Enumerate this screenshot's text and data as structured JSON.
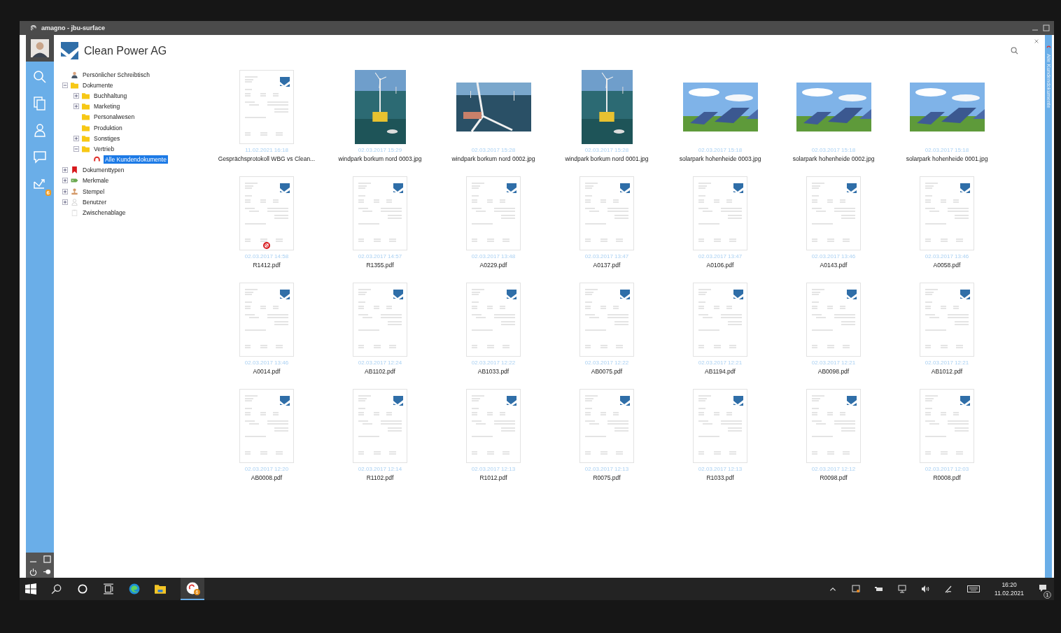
{
  "window": {
    "title": "amagno - jbu-surface"
  },
  "sidebar": {
    "inbox_badge": "6"
  },
  "header": {
    "title": "Clean Power AG"
  },
  "side_strip": {
    "label": "Alle Kundendokumente"
  },
  "tree": [
    {
      "label": "Persönlicher Schreibtisch",
      "kind": "person",
      "selected": false
    },
    {
      "label": "Dokumente",
      "kind": "folder",
      "selected": false,
      "expanded": true,
      "children": [
        {
          "label": "Buchhaltung",
          "kind": "folder",
          "selected": false,
          "expanded": false
        },
        {
          "label": "Marketing",
          "kind": "folder",
          "selected": false,
          "expanded": false
        },
        {
          "label": "Personalwesen",
          "kind": "folder",
          "selected": false
        },
        {
          "label": "Produktion",
          "kind": "folder",
          "selected": false
        },
        {
          "label": "Sonstiges",
          "kind": "folder",
          "selected": false,
          "expanded": false
        },
        {
          "label": "Vertrieb",
          "kind": "folder",
          "selected": false,
          "expanded": true,
          "children": [
            {
              "label": "Alle Kundendokumente",
              "kind": "query",
              "selected": true
            }
          ]
        }
      ]
    },
    {
      "label": "Dokumenttypen",
      "kind": "bookmark",
      "selected": false,
      "expanded": false
    },
    {
      "label": "Merkmale",
      "kind": "tag",
      "selected": false,
      "expanded": false
    },
    {
      "label": "Stempel",
      "kind": "stamp",
      "selected": false,
      "expanded": false
    },
    {
      "label": "Benutzer",
      "kind": "user",
      "selected": false,
      "expanded": false
    },
    {
      "label": "Zwischenablage",
      "kind": "clipboard",
      "selected": false
    }
  ],
  "files": [
    {
      "kind": "document",
      "date": "11.02.2021 16:18",
      "name": "Gesprächsprotokoll WBG vs Clean...",
      "marked": false
    },
    {
      "kind": "picture",
      "date": "02.03.2017 15:29",
      "name": "windpark borkum nord 0003.jpg"
    },
    {
      "kind": "picture",
      "date": "02.03.2017 15:28",
      "name": "windpark borkum nord 0002.jpg"
    },
    {
      "kind": "picture",
      "date": "02.03.2017 15:28",
      "name": "windpark borkum nord 0001.jpg"
    },
    {
      "kind": "picture",
      "date": "02.03.2017 15:18",
      "name": "solarpark hohenheide 0003.jpg"
    },
    {
      "kind": "picture",
      "date": "02.03.2017 15:18",
      "name": "solarpark hohenheide 0002.jpg"
    },
    {
      "kind": "picture",
      "date": "02.03.2017 15:18",
      "name": "solarpark hohenheide 0001.jpg"
    },
    {
      "kind": "document",
      "date": "02.03.2017 14:58",
      "name": "R1412.pdf",
      "marked": true
    },
    {
      "kind": "document",
      "date": "02.03.2017 14:57",
      "name": "R1355.pdf",
      "marked": false
    },
    {
      "kind": "document",
      "date": "02.03.2017 13:48",
      "name": "A0229.pdf",
      "marked": false
    },
    {
      "kind": "document",
      "date": "02.03.2017 13:47",
      "name": "A0137.pdf",
      "marked": false
    },
    {
      "kind": "document",
      "date": "02.03.2017 13:47",
      "name": "A0106.pdf",
      "marked": false
    },
    {
      "kind": "document",
      "date": "02.03.2017 13:46",
      "name": "A0143.pdf",
      "marked": false
    },
    {
      "kind": "document",
      "date": "02.03.2017 13:46",
      "name": "A0058.pdf",
      "marked": false
    },
    {
      "kind": "document",
      "date": "02.03.2017 13:46",
      "name": "A0014.pdf",
      "marked": false
    },
    {
      "kind": "document",
      "date": "02.03.2017 12:24",
      "name": "AB1102.pdf",
      "marked": false
    },
    {
      "kind": "document",
      "date": "02.03.2017 12:22",
      "name": "AB1033.pdf",
      "marked": false
    },
    {
      "kind": "document",
      "date": "02.03.2017 12:22",
      "name": "AB0075.pdf",
      "marked": false
    },
    {
      "kind": "document",
      "date": "02.03.2017 12:21",
      "name": "AB1194.pdf",
      "marked": false
    },
    {
      "kind": "document",
      "date": "02.03.2017 12:21",
      "name": "AB0098.pdf",
      "marked": false
    },
    {
      "kind": "document",
      "date": "02.03.2017 12:21",
      "name": "AB1012.pdf",
      "marked": false
    },
    {
      "kind": "document",
      "date": "02.03.2017 12:20",
      "name": "AB0008.pdf",
      "marked": false
    },
    {
      "kind": "document",
      "date": "02.03.2017 12:14",
      "name": "R1102.pdf",
      "marked": false
    },
    {
      "kind": "document",
      "date": "02.03.2017 12:13",
      "name": "R1012.pdf",
      "marked": false
    },
    {
      "kind": "document",
      "date": "02.03.2017 12:13",
      "name": "R0075.pdf",
      "marked": false
    },
    {
      "kind": "document",
      "date": "02.03.2017 12:13",
      "name": "R1033.pdf",
      "marked": false
    },
    {
      "kind": "document",
      "date": "02.03.2017 12:12",
      "name": "R0098.pdf",
      "marked": false
    },
    {
      "kind": "document",
      "date": "02.03.2017 12:03",
      "name": "R0008.pdf",
      "marked": false
    }
  ],
  "taskbar": {
    "app_badge": "6",
    "time": "16:20",
    "date": "11.02.2021",
    "notifications": "1"
  }
}
